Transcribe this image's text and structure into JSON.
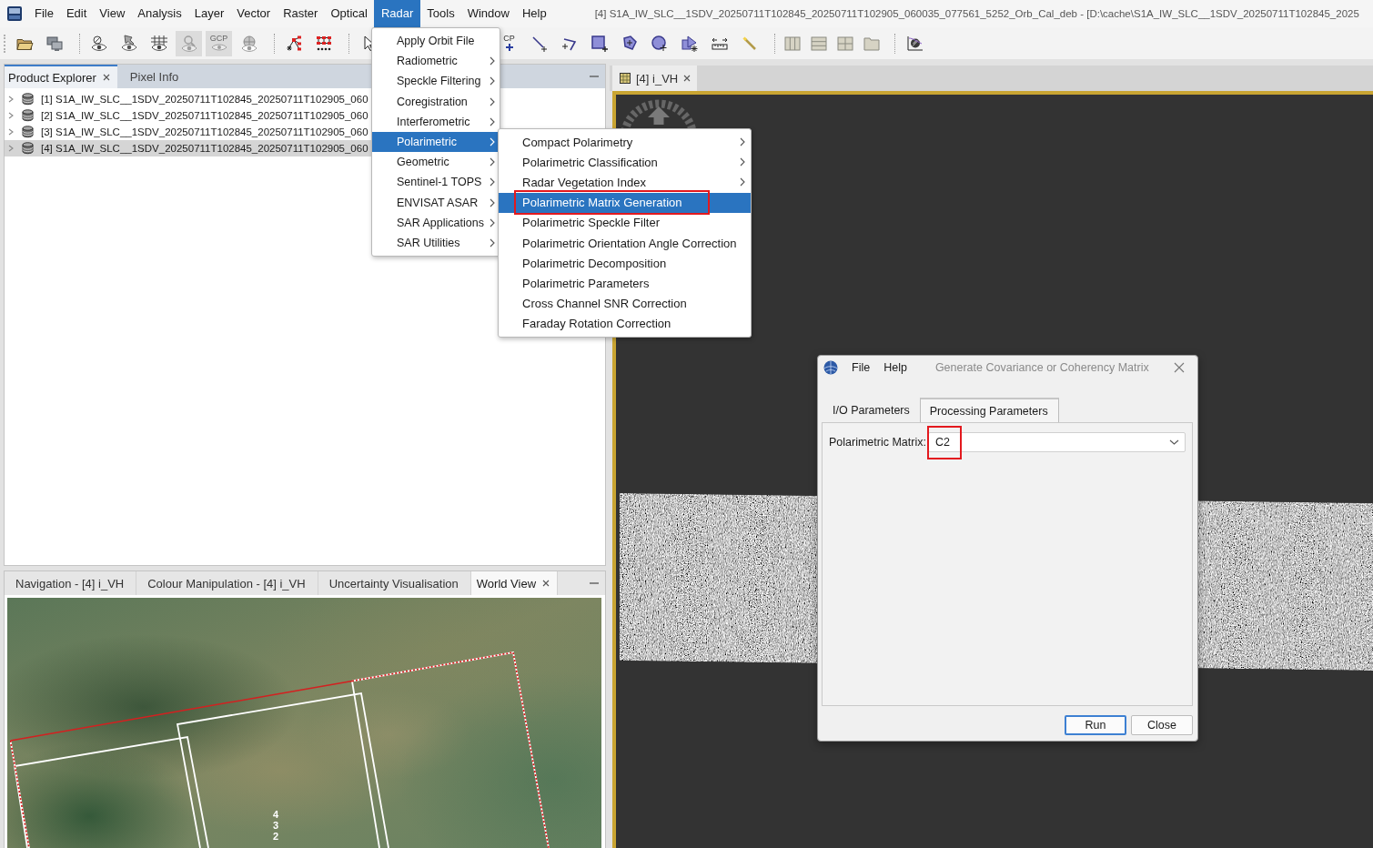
{
  "menu_bar": {
    "items": [
      {
        "label": "File",
        "selected": false
      },
      {
        "label": "Edit",
        "selected": false
      },
      {
        "label": "View",
        "selected": false
      },
      {
        "label": "Analysis",
        "selected": false
      },
      {
        "label": "Layer",
        "selected": false
      },
      {
        "label": "Vector",
        "selected": false
      },
      {
        "label": "Raster",
        "selected": false
      },
      {
        "label": "Optical",
        "selected": false
      },
      {
        "label": "Radar",
        "selected": true
      },
      {
        "label": "Tools",
        "selected": false
      },
      {
        "label": "Window",
        "selected": false
      },
      {
        "label": "Help",
        "selected": false
      }
    ]
  },
  "window": {
    "title": "[4] S1A_IW_SLC__1SDV_20250711T102845_20250711T102905_060035_077561_5252_Orb_Cal_deb - [D:\\cache\\S1A_IW_SLC__1SDV_20250711T102845_2025"
  },
  "toolbar": {
    "groups": [
      [
        {
          "disabled": false
        },
        {
          "disabled": false
        }
      ],
      [
        {
          "disabled": false
        },
        {
          "disabled": false
        },
        {
          "disabled": false
        },
        {
          "disabled": true
        },
        {
          "disabled": true,
          "label": "GCP"
        },
        {
          "disabled": false
        }
      ],
      [
        {
          "disabled": false
        },
        {
          "disabled": false
        }
      ],
      [
        {
          "disabled": false
        },
        {
          "disabled": false,
          "label": "CP"
        },
        {
          "disabled": false
        },
        {
          "disabled": false
        },
        {
          "disabled": false
        },
        {
          "disabled": false
        },
        {
          "disabled": false
        },
        {
          "disabled": false
        },
        {
          "disabled": false
        },
        {
          "disabled": false
        }
      ],
      [
        {
          "disabled": false
        },
        {
          "disabled": false
        },
        {
          "disabled": false
        },
        {
          "disabled": false
        }
      ],
      [
        {
          "disabled": false
        }
      ]
    ]
  },
  "product_explorer": {
    "tabs": [
      {
        "label": "Product Explorer",
        "selected": true
      },
      {
        "label": "Pixel Info",
        "selected": false
      }
    ],
    "products": [
      {
        "label": "[1] S1A_IW_SLC__1SDV_20250711T102845_20250711T102905_060",
        "selected": false,
        "expanded": false
      },
      {
        "label": "[2] S1A_IW_SLC__1SDV_20250711T102845_20250711T102905_060",
        "selected": false,
        "expanded": false
      },
      {
        "label": "[3] S1A_IW_SLC__1SDV_20250711T102845_20250711T102905_060",
        "selected": false,
        "expanded": false
      },
      {
        "label": "[4] S1A_IW_SLC__1SDV_20250711T102845_20250711T102905_060",
        "selected": true,
        "expanded": false
      }
    ]
  },
  "tool_windows": {
    "tabs": [
      {
        "label": "Navigation - [4] i_VH",
        "selected": false
      },
      {
        "label": "Colour Manipulation - [4] i_VH",
        "selected": false
      },
      {
        "label": "Uncertainty Visualisation",
        "selected": false
      },
      {
        "label": "World View",
        "selected": true
      }
    ],
    "world_view": {
      "footprint_labels": [
        "4",
        "3",
        "2"
      ]
    }
  },
  "image_view": {
    "tabs": [
      {
        "label": "[4] i_VH",
        "selected": true
      }
    ]
  },
  "radar_menu": {
    "items": [
      {
        "label": "Apply Orbit File",
        "submenu": false,
        "selected": false
      },
      {
        "label": "Radiometric",
        "submenu": true,
        "selected": false
      },
      {
        "label": "Speckle Filtering",
        "submenu": true,
        "selected": false
      },
      {
        "label": "Coregistration",
        "submenu": true,
        "selected": false
      },
      {
        "label": "Interferometric",
        "submenu": true,
        "selected": false
      },
      {
        "label": "Polarimetric",
        "submenu": true,
        "selected": true
      },
      {
        "label": "Geometric",
        "submenu": true,
        "selected": false
      },
      {
        "label": "Sentinel-1 TOPS",
        "submenu": true,
        "selected": false
      },
      {
        "label": "ENVISAT ASAR",
        "submenu": true,
        "selected": false
      },
      {
        "label": "SAR Applications",
        "submenu": true,
        "selected": false
      },
      {
        "label": "SAR Utilities",
        "submenu": true,
        "selected": false
      }
    ]
  },
  "polarimetric_menu": {
    "items": [
      {
        "label": "Compact Polarimetry",
        "submenu": true,
        "selected": false,
        "highlighted": false
      },
      {
        "label": "Polarimetric Classification",
        "submenu": true,
        "selected": false,
        "highlighted": false
      },
      {
        "label": "Radar Vegetation Index",
        "submenu": true,
        "selected": false,
        "highlighted": false
      },
      {
        "label": "Polarimetric Matrix Generation",
        "submenu": false,
        "selected": true,
        "highlighted": true
      },
      {
        "label": "Polarimetric Speckle Filter",
        "submenu": false,
        "selected": false,
        "highlighted": false
      },
      {
        "label": "Polarimetric Orientation Angle Correction",
        "submenu": false,
        "selected": false,
        "highlighted": false
      },
      {
        "label": "Polarimetric Decomposition",
        "submenu": false,
        "selected": false,
        "highlighted": false
      },
      {
        "label": "Polarimetric Parameters",
        "submenu": false,
        "selected": false,
        "highlighted": false
      },
      {
        "label": "Cross Channel SNR Correction",
        "submenu": false,
        "selected": false,
        "highlighted": false
      },
      {
        "label": "Faraday Rotation Correction",
        "submenu": false,
        "selected": false,
        "highlighted": false
      }
    ]
  },
  "dialog": {
    "menu": [
      "File",
      "Help"
    ],
    "title": "Generate Covariance or Coherency Matrix",
    "tabs": [
      {
        "label": "I/O Parameters",
        "selected": false
      },
      {
        "label": "Processing Parameters",
        "selected": true
      }
    ],
    "fields": [
      {
        "label": "Polarimetric Matrix:",
        "value": "C2",
        "highlighted": true
      }
    ],
    "buttons": [
      {
        "label": "Run",
        "default": true
      },
      {
        "label": "Close",
        "default": false
      }
    ]
  }
}
